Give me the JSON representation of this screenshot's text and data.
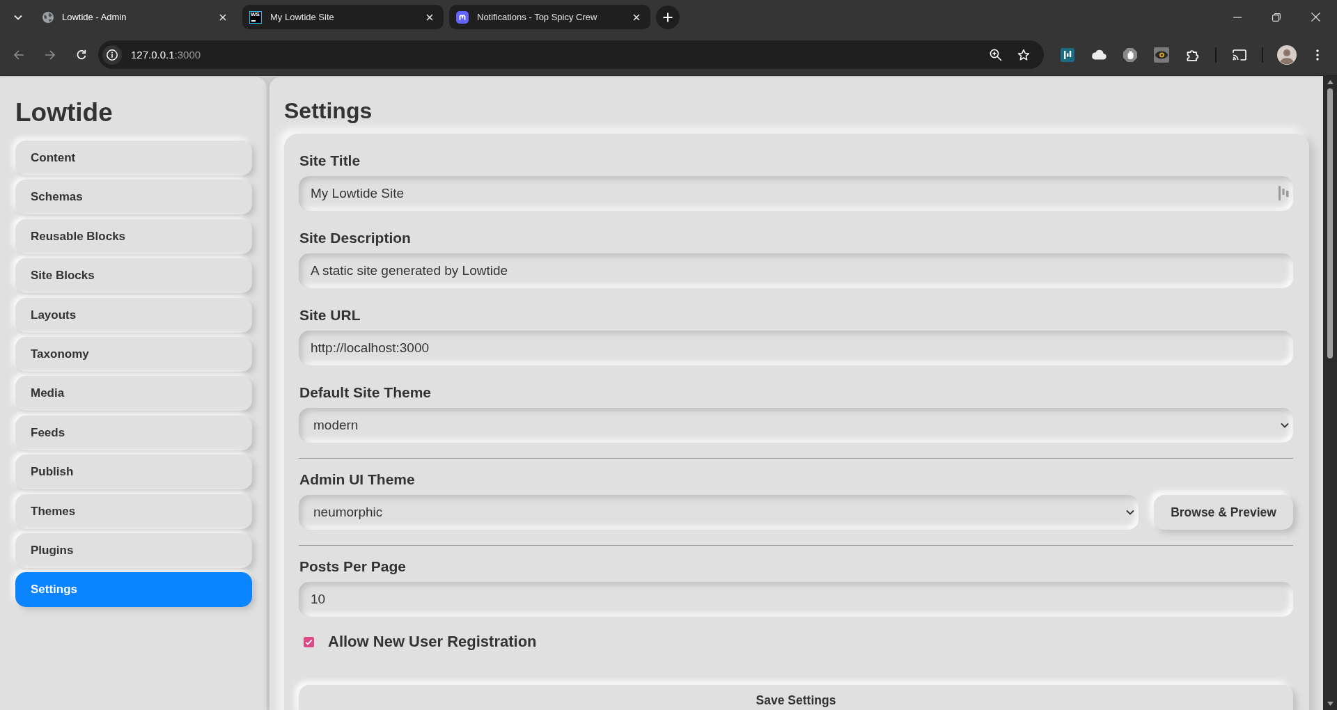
{
  "browser": {
    "tabs": [
      {
        "title": "Lowtide - Admin",
        "selected": true,
        "kind": "globe"
      },
      {
        "title": "My Lowtide Site",
        "selected": false,
        "kind": "editor",
        "icon_text": "WS"
      },
      {
        "title": "Notifications - Top Spicy Crew",
        "selected": false,
        "kind": "social"
      }
    ],
    "address": {
      "host": "127.0.0.1",
      "port": ":3000"
    }
  },
  "sidebar": {
    "title": "Lowtide",
    "items": [
      {
        "label": "Content",
        "selected": false
      },
      {
        "label": "Schemas",
        "selected": false
      },
      {
        "label": "Reusable Blocks",
        "selected": false
      },
      {
        "label": "Site Blocks",
        "selected": false
      },
      {
        "label": "Layouts",
        "selected": false
      },
      {
        "label": "Taxonomy",
        "selected": false
      },
      {
        "label": "Media",
        "selected": false
      },
      {
        "label": "Feeds",
        "selected": false
      },
      {
        "label": "Publish",
        "selected": false
      },
      {
        "label": "Themes",
        "selected": false
      },
      {
        "label": "Plugins",
        "selected": false
      },
      {
        "label": "Settings",
        "selected": true
      }
    ]
  },
  "main": {
    "title": "Settings",
    "sections": [
      {
        "fields": [
          {
            "kind": "text",
            "label": "Site Title",
            "value": "My Lowtide Site",
            "extension_icon": true
          },
          {
            "kind": "text",
            "label": "Site Description",
            "value": "A static site generated by Lowtide",
            "extension_icon": false
          },
          {
            "kind": "text",
            "label": "Site URL",
            "value": "http://localhost:3000",
            "extension_icon": false
          },
          {
            "kind": "select",
            "label": "Default Site Theme",
            "value": "modern"
          }
        ]
      },
      {
        "fields": [
          {
            "kind": "select",
            "label": "Admin UI Theme",
            "value": "neumorphic",
            "button": "Browse & Preview"
          }
        ]
      },
      {
        "fields": [
          {
            "kind": "text",
            "label": "Posts Per Page",
            "value": "10",
            "extension_icon": false
          },
          {
            "kind": "checkbox",
            "label": "Allow New User Registration",
            "checked": true
          }
        ]
      }
    ],
    "submit": "Save Settings"
  }
}
